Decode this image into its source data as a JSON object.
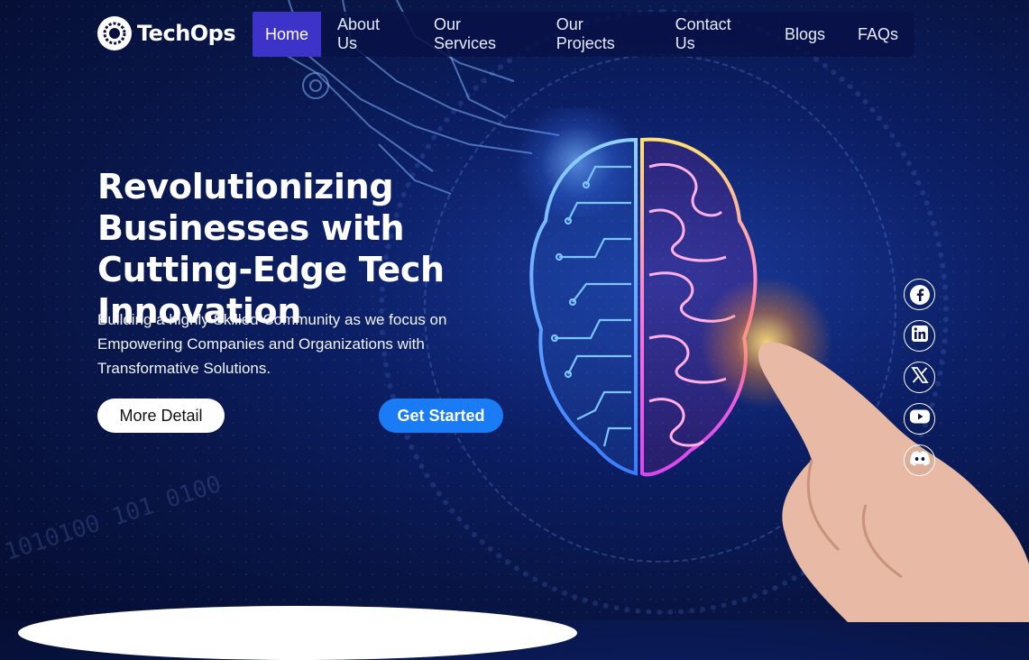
{
  "brand": {
    "name": "TechOps"
  },
  "nav": {
    "items": [
      {
        "label": "Home",
        "active": true
      },
      {
        "label": "About Us"
      },
      {
        "label": "Our Services"
      },
      {
        "label": "Our Projects"
      },
      {
        "label": "Contact Us"
      },
      {
        "label": "Blogs"
      },
      {
        "label": "FAQs"
      }
    ]
  },
  "hero": {
    "title": "Revolutionizing Businesses with Cutting-Edge Tech Innovation",
    "subtitle": "Building a highly Skilled Community as we focus on Empowering Companies and Organizations with Transformative Solutions.",
    "more_detail_label": "More Detail",
    "get_started_label": "Get Started"
  },
  "socials": [
    "facebook-icon",
    "linkedin-icon",
    "x-icon",
    "youtube-icon",
    "discord-icon"
  ],
  "background": {
    "binary_text": "1010100 101 0100"
  },
  "colors": {
    "accent": "#1a7cf5",
    "nav_active": "#3d33c9",
    "background": "#0c1f66"
  }
}
